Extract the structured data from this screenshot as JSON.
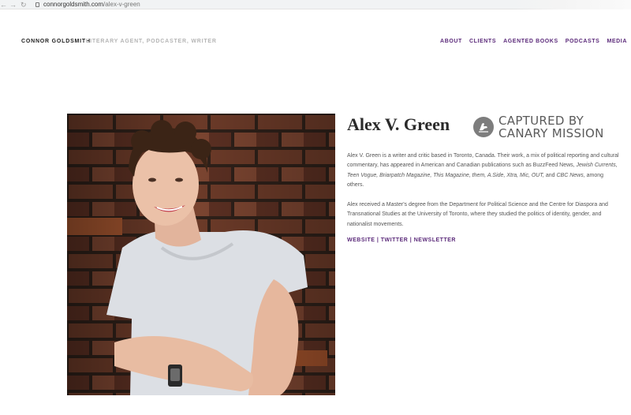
{
  "browser": {
    "url_domain": "connorgoldsmith.com",
    "url_path": "/alex-v-green"
  },
  "header": {
    "brand": "CONNOR GOLDSMITH",
    "tagline": "LITERARY AGENT, PODCASTER, WRITER",
    "nav": [
      "ABOUT",
      "CLIENTS",
      "AGENTED BOOKS",
      "PODCASTS",
      "MEDIA"
    ]
  },
  "profile": {
    "name": "Alex V. Green",
    "badge_line1": "CAPTURED BY",
    "badge_line2": "CANARY MISSION",
    "bio1_before": "Alex V. Green is a writer and critic based in Toronto, Canada. Their work, a mix of political reporting and cultural commentary, has appeared in American and Canadian publications such as BuzzFeed News, ",
    "bio1_italic": "Jewish Currents, Teen Vogue, Briarpatch Magazine, This Magazine, them, A.Side, Xtra, Mic, OUT,",
    "bio1_mid": " and ",
    "bio1_italic2": "CBC News",
    "bio1_after": ", among others.",
    "bio2": "Alex received a Master's degree from the Department for Political Science and the Centre for Diaspora and Transnational Studies at the University of Toronto, where they studied the politics of identity, gender, and nationalist movements.",
    "links": {
      "website": "WEBSITE",
      "separator": " | ",
      "twitter": "TWITTER",
      "newsletter": "NEWSLETTER"
    }
  },
  "colors": {
    "accent": "#5b2a7a",
    "brick": "#6b3a28",
    "mortar": "#2e2019"
  }
}
